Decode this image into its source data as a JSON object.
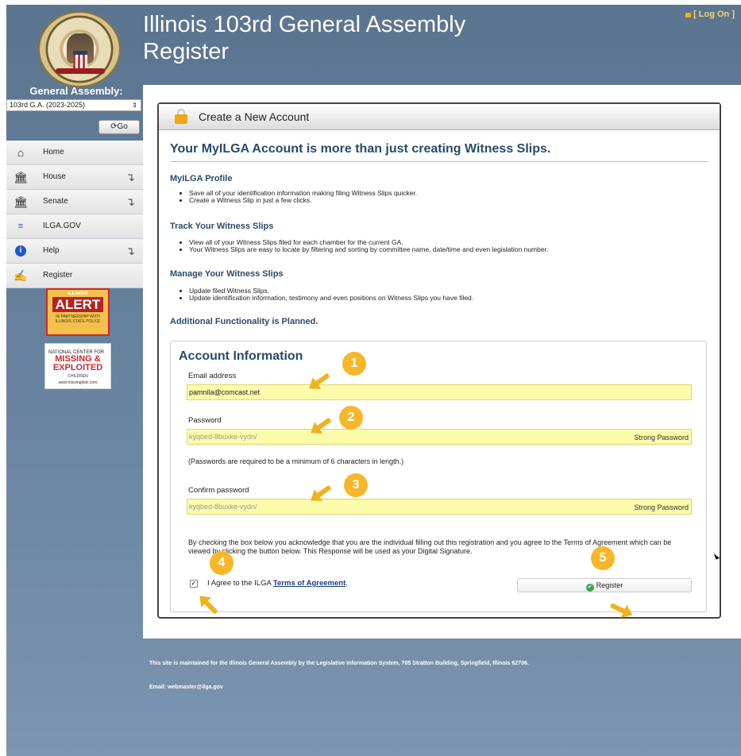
{
  "header": {
    "title_line1": "Illinois 103rd General Assembly",
    "title_line2": "Register",
    "logon": "[ Log On ]"
  },
  "sidebar": {
    "ga_label": "General Assembly:",
    "ga_select_value": "103rd G.A. (2023-2025)",
    "go_label": "Go",
    "items": [
      {
        "label": "Home",
        "icon": "home-icon",
        "has_sub": false
      },
      {
        "label": "House",
        "icon": "house-building-icon",
        "has_sub": true
      },
      {
        "label": "Senate",
        "icon": "senate-building-icon",
        "has_sub": true
      },
      {
        "label": "ILGA.GOV",
        "icon": "ilga-icon",
        "has_sub": false
      },
      {
        "label": "Help",
        "icon": "info-icon",
        "has_sub": true
      },
      {
        "label": "Register",
        "icon": "register-icon",
        "has_sub": false
      }
    ],
    "amber": {
      "top": "ILLINOIS",
      "main": "ALERT",
      "bottom": "IN PARTNERSHIP WITH ILLINOIS STATE POLICE"
    },
    "missing": {
      "line1": "NATIONAL CENTER FOR",
      "line2": "MISSING & EXPLOITED",
      "line3": "CHILDREN",
      "url": "www.missingkids.com"
    }
  },
  "panel": {
    "title": "Create a New Account",
    "heading": "Your MyILGA Account is more than just creating Witness Slips.",
    "sections": [
      {
        "title": "MyILGA Profile",
        "bullets": [
          "Save all of your identification information making filing Witness Slips quicker.",
          "Create a Witness Slip in just a few clicks."
        ]
      },
      {
        "title": "Track Your Witness Slips",
        "bullets": [
          "View all of your Witness Slips filed for each chamber for the current GA.",
          "Your Witness Slips are easy to locate by filtering and sorting by committee name, date/time and even legislation number."
        ]
      },
      {
        "title": "Manage Your Witness Slips",
        "bullets": [
          "Update filed Witness Slips.",
          "Update identification information, testimony and even positions on Witness Slips you have filed."
        ]
      }
    ],
    "functionality": "Additional Functionality is Planned."
  },
  "account": {
    "heading": "Account Information",
    "email_label": "Email address",
    "email_value": "pamnila@comcast.net",
    "password_label": "Password",
    "password_value": "kyqbed-8buxke-vydn/",
    "password_strength": "Strong Password",
    "password_note": "(Passwords are required to be a minimum of 6 characters in length.)",
    "confirm_label": "Confirm password",
    "confirm_value": "kyqbed-8buxke-vydn/",
    "confirm_strength": "Strong Password",
    "ack_text": "By checking the box below you acknowledge that you are the individual filling out this registration and you agree to the Terms of Agreement which can be viewed by clicking the button below. This Response will be used as your Digital Signature.",
    "agree_prefix": "I Agree to the ILGA ",
    "agree_link": "Terms of Agreement",
    "agree_suffix": ".",
    "agree_checked": "✓",
    "register_label": "Register"
  },
  "badges": [
    "1",
    "2",
    "3",
    "4",
    "5"
  ],
  "footer": {
    "maintained": "This site is maintained for the Illinois General Assembly by the Legislative Information System, 705 Stratton Building, Springfield, Illinois 62706.",
    "email": "Email: webmaster@ilga.gov"
  },
  "colors": {
    "accent": "#2a4a6a",
    "badge": "#f6b82a",
    "field": "#fbfbaa",
    "header_bg": "#5b7590"
  }
}
